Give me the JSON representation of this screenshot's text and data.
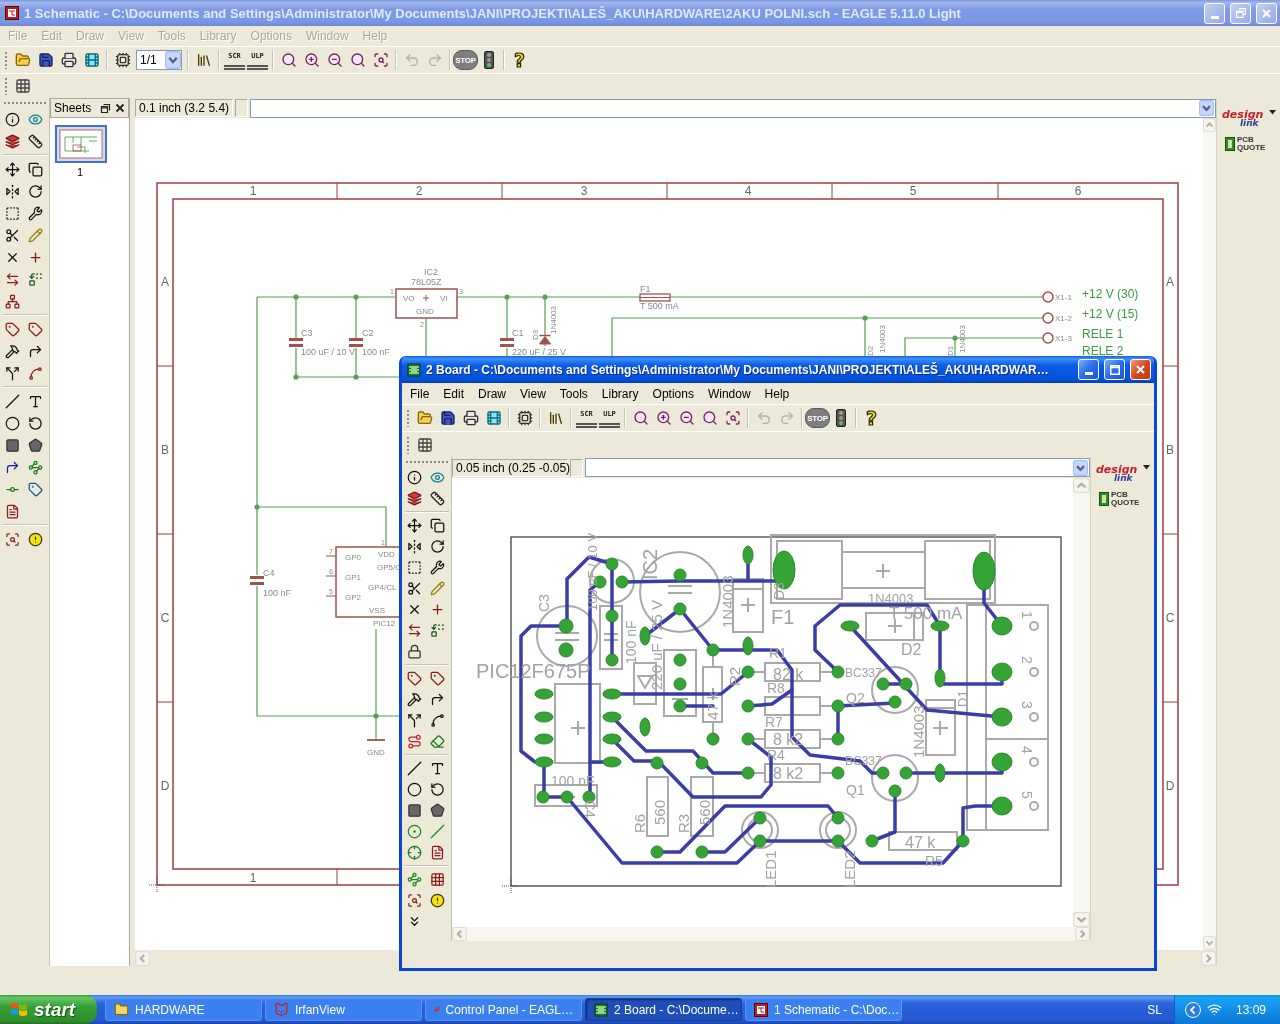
{
  "main_window": {
    "title": "1 Schematic - C:\\Documents and Settings\\Administrator\\My Documents\\JANI\\PROJEKTI\\ALEŠ_AKU\\HARDWARE\\2AKU POLNI.sch - EAGLE 5.11.0 Light",
    "active": false,
    "maximized": true,
    "menu": [
      {
        "label": "File",
        "disabled": true
      },
      {
        "label": "Edit",
        "disabled": true
      },
      {
        "label": "Draw",
        "disabled": true
      },
      {
        "label": "View",
        "disabled": true
      },
      {
        "label": "Tools",
        "disabled": true
      },
      {
        "label": "Library",
        "disabled": true
      },
      {
        "label": "Options",
        "disabled": true
      },
      {
        "label": "Window",
        "disabled": true
      },
      {
        "label": "Help",
        "disabled": true
      }
    ],
    "toolbar": {
      "sheet": "1/1",
      "script": "SCR",
      "ulp": "ULP",
      "undo": {
        "disabled": true
      },
      "redo": {
        "disabled": true
      },
      "stop": {
        "label": "STOP",
        "disabled": true
      },
      "help": "?"
    },
    "sheets_panel": {
      "title": "Sheets",
      "sheets": [
        {
          "label": "1",
          "selected": true
        }
      ]
    },
    "command_bar": {
      "coordinates": "0.1 inch (3.2 5.4)"
    },
    "schematic": {
      "frame": {
        "columns": [
          "1",
          "2",
          "3",
          "4",
          "5",
          "6"
        ],
        "rows_left": [
          "A",
          "B",
          "C",
          "D"
        ],
        "rows_right": [
          "A",
          "B",
          "C",
          "D"
        ],
        "bottom_columns": [
          "1"
        ]
      },
      "labels": [
        "IC2",
        "78L05Z",
        "1",
        "3",
        "VO",
        "VI",
        "GND",
        "2",
        "C3",
        "100 uF / 10 V",
        "C2",
        "100 nF",
        "C1",
        "220 uF / 25 V",
        "D3",
        "1N4003",
        "F1",
        "T 500 mA",
        "D2",
        "1N4003",
        "D1",
        "1N4003",
        "X1-1",
        "X1-2",
        "X1-3",
        "C4",
        "100 nF",
        "GP0",
        "GP1",
        "GP2",
        "7",
        "6",
        "5",
        "1",
        "VDD",
        "GP5/C",
        "GP4/CL",
        "VSS",
        "PIC12",
        "GND"
      ],
      "net_labels": [
        "+12 V (30)",
        "+12 V (15)",
        "RELE 1",
        "RELE 2"
      ]
    },
    "side_panel": {
      "logo_top": "design",
      "logo_bottom": "link",
      "quote": "PCB QUOTE"
    }
  },
  "board_window": {
    "title": "2 Board - C:\\Documents and Settings\\Administrator\\My Documents\\JANI\\PROJEKTI\\ALEŠ_AKU\\HARDWAR…",
    "active": true,
    "maximized": false,
    "menu": [
      {
        "label": "File",
        "disabled": false
      },
      {
        "label": "Edit",
        "disabled": false
      },
      {
        "label": "Draw",
        "disabled": false
      },
      {
        "label": "View",
        "disabled": false
      },
      {
        "label": "Tools",
        "disabled": false
      },
      {
        "label": "Library",
        "disabled": false
      },
      {
        "label": "Options",
        "disabled": false
      },
      {
        "label": "Window",
        "disabled": false
      },
      {
        "label": "Help",
        "disabled": false
      }
    ],
    "toolbar": {
      "script": "SCR",
      "ulp": "ULP",
      "undo": {
        "disabled": true
      },
      "redo": {
        "disabled": true
      },
      "stop": {
        "label": "STOP",
        "disabled": true
      },
      "help": "?"
    },
    "command_bar": {
      "coordinates": "0.05 inch (0.25 -0.05)"
    },
    "board": {
      "labels": [
        "C3",
        "100 uF / 10 V",
        "IC2",
        "220 uF / 25 V",
        "100 nF",
        "D3",
        "1N4003",
        "F1",
        "T 500 mA",
        "1N4003",
        "R1",
        "D2",
        "82 k",
        "R2",
        "47 k",
        "BC337",
        "R8",
        "Q2",
        "R7",
        "8 k2",
        "R4",
        "8 k2",
        "BC337",
        "Q1",
        "1N4003",
        "D1",
        "R6",
        "560",
        "R3",
        "560",
        "LED1",
        "LED2",
        "47 k",
        "R5",
        "PIC12F675P",
        "100 nF",
        "C4"
      ],
      "connector_pins": [
        "1",
        "2",
        "3",
        "4",
        "5"
      ]
    },
    "side_panel": {
      "logo_top": "design",
      "logo_bottom": "link",
      "quote": "PCB QUOTE"
    }
  },
  "taskbar": {
    "start": "start",
    "tasks": [
      {
        "label": "HARDWARE",
        "kind": "folder",
        "selected": false
      },
      {
        "label": "IrfanView",
        "kind": "viewer",
        "selected": false
      },
      {
        "label": "Control Panel - EAGL…",
        "kind": "control-panel",
        "selected": false
      },
      {
        "label": "2 Board - C:\\Docume…",
        "kind": "board",
        "selected": true
      },
      {
        "label": "1 Schematic - C:\\Doc…",
        "kind": "schematic",
        "selected": false
      }
    ],
    "language": "SL",
    "clock": "13:09"
  }
}
